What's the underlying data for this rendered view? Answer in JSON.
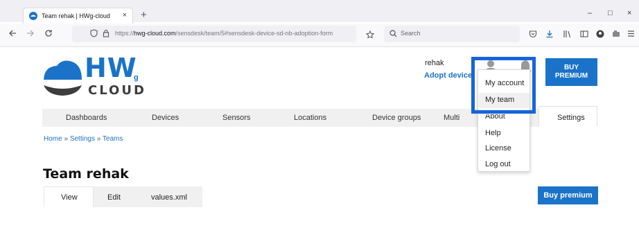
{
  "browser": {
    "tab_title": "Team rehak | HWg-cloud",
    "tab_close": "×",
    "new_tab": "+",
    "url_scheme": "https://",
    "url_host": "hwg-cloud.com",
    "url_path": "/sensdesk/team/5#sensdesk-device-sd-nb-adoption-form",
    "search_placeholder": "Search",
    "window_controls": [
      "–",
      "□",
      "×"
    ]
  },
  "header": {
    "logo_hw": "HW",
    "logo_g": "g",
    "logo_cloud": "CLOUD",
    "username": "rehak",
    "adopt_link": "Adopt device",
    "buy_premium_line1": "BUY",
    "buy_premium_line2": "PREMIUM"
  },
  "mainnav": {
    "items": [
      "Dashboards",
      "Devices",
      "Sensors",
      "Locations",
      "Device groups",
      "Multi",
      "Settings"
    ]
  },
  "breadcrumb": {
    "home": "Home",
    "settings": "Settings",
    "teams": "Teams",
    "separator": "»"
  },
  "page": {
    "title": "Team rehak",
    "subtabs": [
      "View",
      "Edit",
      "values.xml"
    ],
    "buy_premium_button": "Buy premium"
  },
  "dropdown": {
    "items": [
      "My account",
      "My team",
      "About",
      "Help",
      "License",
      "Log out"
    ]
  },
  "colors": {
    "brand_blue": "#1a73c8",
    "highlight_blue": "#1565d8"
  },
  "icons": [
    "hwg-cloud-favicon",
    "back-arrow-icon",
    "forward-arrow-icon",
    "reload-icon",
    "shield-icon",
    "lock-icon",
    "bookmark-star-icon",
    "search-icon",
    "pocket-icon",
    "download-icon",
    "library-icon",
    "sidebar-icon",
    "profile-icon",
    "extensions-icon",
    "menu-icon",
    "user-icon",
    "bell-icon"
  ]
}
